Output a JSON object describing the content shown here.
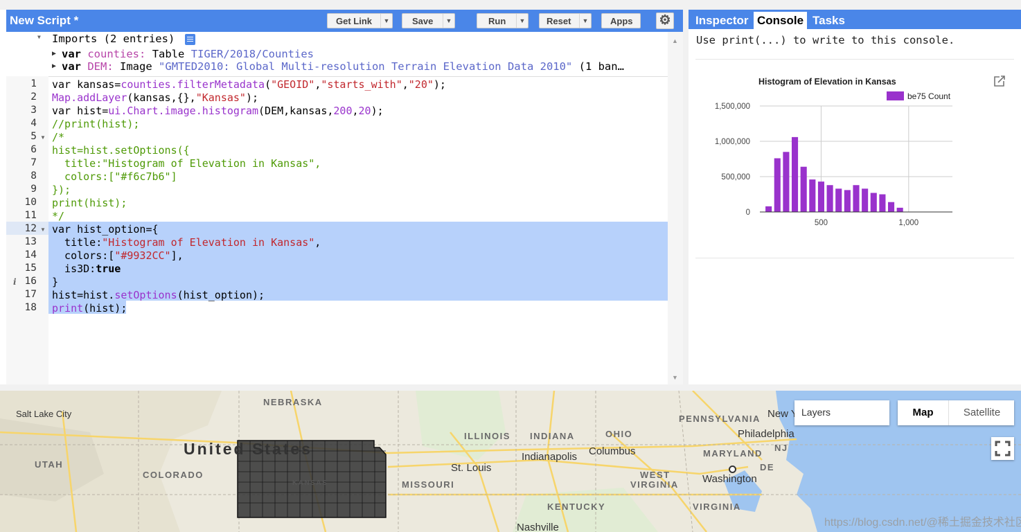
{
  "editor": {
    "title": "New Script *",
    "buttons": {
      "get_link": "Get Link",
      "save": "Save",
      "run": "Run",
      "reset": "Reset",
      "apps": "Apps"
    },
    "imports": {
      "header": "Imports (2 entries)",
      "entries": [
        {
          "keyword": "var",
          "name": "counties:",
          "type": "Table",
          "source": "TIGER/2018/Counties",
          "extra": ""
        },
        {
          "keyword": "var",
          "name": "DEM:",
          "type": "Image",
          "source": "\"GMTED2010: Global Multi-resolution Terrain Elevation Data 2010\"",
          "extra": "(1 ban…"
        }
      ]
    },
    "line_numbers": [
      "1",
      "2",
      "3",
      "4",
      "5",
      "6",
      "7",
      "8",
      "9",
      "10",
      "11",
      "12",
      "13",
      "14",
      "15",
      "16",
      "17",
      "18"
    ],
    "code": {
      "l1a": "var kansas=",
      "l1b": "counties.filterMetadata",
      "l1c": "(",
      "l1d": "\"GEOID\"",
      "l1e": ",",
      "l1f": "\"starts_with\"",
      "l1g": ",",
      "l1h": "\"20\"",
      "l1i": ");",
      "l2a": "Map.addLayer",
      "l2b": "(kansas,{},",
      "l2c": "\"Kansas\"",
      "l2d": ");",
      "l3a": "var hist=",
      "l3b": "ui.Chart.image.histogram",
      "l3c": "(DEM,kansas,",
      "l3d": "200",
      "l3e": ",",
      "l3f": "20",
      "l3g": ");",
      "l4": "//print(hist);",
      "l5": "/*",
      "l6": "hist=hist.setOptions({",
      "l7": "  title:\"Histogram of Elevation in Kansas\",",
      "l8": "  colors:[\"#f6c7b6\"]",
      "l9": "});",
      "l10": "print(hist);",
      "l11": "*/",
      "l12": "var hist_option={",
      "l13a": "  title:",
      "l13b": "\"Histogram of Elevation in Kansas\"",
      "l13c": ",",
      "l14a": "  colors:[",
      "l14b": "\"#9932CC\"",
      "l14c": "],",
      "l15a": "  is3D:",
      "l15b": "true",
      "l16": "}",
      "l17a": "hist=hist.",
      "l17b": "setOptions",
      "l17c": "(hist_option);",
      "l18a": "print",
      "l18b": "(hist);"
    }
  },
  "panel": {
    "tabs": [
      "Inspector",
      "Console",
      "Tasks"
    ],
    "active_tab": "Console",
    "console_message": "Use print(...) to write to this console."
  },
  "chart_data": {
    "type": "bar",
    "title": "Histogram of Elevation in Kansas",
    "legend": "be75 Count",
    "legend_position": "top-right",
    "color": "#9932CC",
    "x": [
      200,
      250,
      300,
      350,
      400,
      450,
      500,
      550,
      600,
      650,
      700,
      750,
      800,
      850,
      900,
      950,
      1000,
      1050,
      1100,
      1150
    ],
    "values": [
      80000,
      760000,
      850000,
      1060000,
      640000,
      460000,
      430000,
      380000,
      330000,
      310000,
      380000,
      330000,
      270000,
      250000,
      140000,
      60000,
      0,
      0,
      0,
      0
    ],
    "xticks": [
      "500",
      "1,000"
    ],
    "xtick_values": [
      500,
      1000
    ],
    "yticks": [
      "0",
      "500,000",
      "1,000,000",
      "1,500,000"
    ],
    "ytick_values": [
      0,
      500000,
      1000000,
      1500000
    ],
    "xlim": [
      150,
      1250
    ],
    "ylim": [
      0,
      1500000
    ],
    "grid": true
  },
  "map": {
    "layers_label": "Layers",
    "map_type": "Map",
    "satellite": "Satellite",
    "country": "United States",
    "kansas_label": "KANSAS",
    "states": [
      "NEBRASKA",
      "UTAH",
      "COLORADO",
      "MISSOURI",
      "ILLINOIS",
      "INDIANA",
      "OHIO",
      "PENNSYLVANIA",
      "MARYLAND",
      "WEST",
      "VIRGINIA",
      "KENTUCKY",
      "VIRGINIA",
      "NJ",
      "DE"
    ],
    "cities": [
      "Salt Lake City",
      "St. Louis",
      "Indianapolis",
      "Columbus",
      "Philadelphia",
      "Washington",
      "New Y",
      "Nashville"
    ],
    "watermark": "https://blog.csdn.net/@稀土掘金技术社区"
  }
}
